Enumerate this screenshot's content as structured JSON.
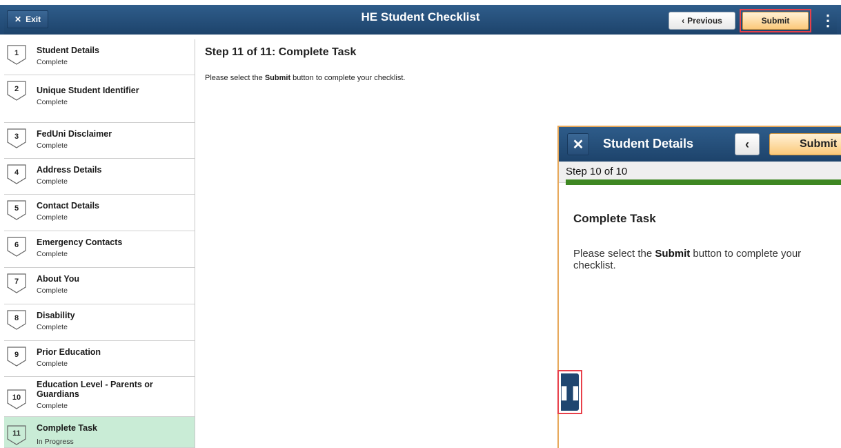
{
  "header": {
    "exit_label": "Exit",
    "title": "HE Student Checklist",
    "previous_label": "Previous",
    "submit_label": "Submit"
  },
  "sidebar": {
    "steps": [
      {
        "num": "1",
        "label": "Student Details",
        "status": "Complete"
      },
      {
        "num": "2",
        "label": "Unique Student Identifier",
        "status": "Complete"
      },
      {
        "num": "3",
        "label": "FedUni Disclaimer",
        "status": "Complete"
      },
      {
        "num": "4",
        "label": "Address Details",
        "status": "Complete"
      },
      {
        "num": "5",
        "label": "Contact Details",
        "status": "Complete"
      },
      {
        "num": "6",
        "label": "Emergency Contacts",
        "status": "Complete"
      },
      {
        "num": "7",
        "label": "About You",
        "status": "Complete"
      },
      {
        "num": "8",
        "label": "Disability",
        "status": "Complete"
      },
      {
        "num": "9",
        "label": "Prior Education",
        "status": "Complete"
      },
      {
        "num": "10",
        "label_line1": "Education Level - Parents or",
        "label_line2": "Guardians",
        "status": "Complete"
      },
      {
        "num": "11",
        "label": "Complete Task",
        "status": "In Progress"
      }
    ]
  },
  "main": {
    "title": "Step 11 of 11: Complete Task",
    "text_before": "Please select the ",
    "text_bold": "Submit",
    "text_after": " button to complete your checklist."
  },
  "mobile": {
    "title": "Student Details",
    "submit_label": "Submit",
    "step_text": "Step 10 of 10",
    "progress": 1.0,
    "content_title": "Complete Task",
    "text_before": "Please select the ",
    "text_bold": "Submit",
    "text_after": " button to complete your checklist."
  },
  "icons": {
    "exit": "close-icon",
    "previous": "chevron-left-icon",
    "more": "kebab-menu-icon",
    "mobile_close": "close-icon",
    "mobile_back": "chevron-left-icon",
    "pause": "pause-icon"
  },
  "colors": {
    "header_blue": "#1f4670",
    "active_step": "#c9ecd6",
    "progress_green": "#3e8722",
    "submit_orange": "#fbc97a",
    "highlight_red": "#e8404a"
  }
}
